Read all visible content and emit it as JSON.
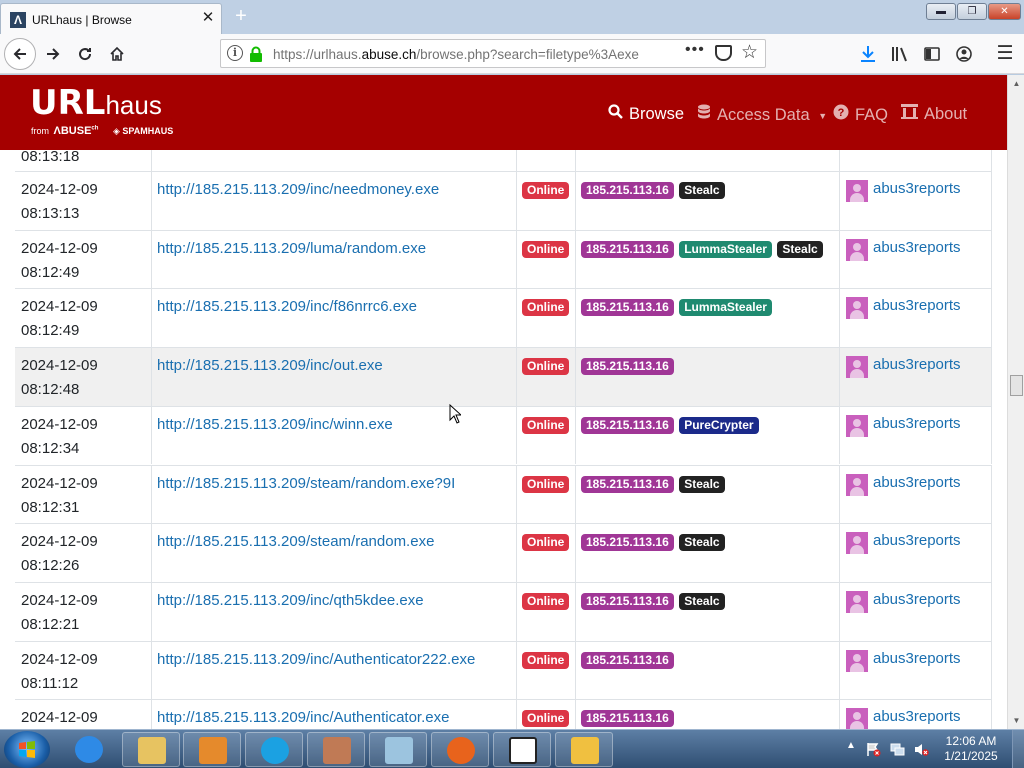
{
  "browser": {
    "tab_title": "URLhaus | Browse",
    "tab_favicon_letter": "Λ",
    "url_prefix": "https://urlhaus.",
    "url_domain": "abuse.ch",
    "url_suffix": "/browse.php?search=filetype%3Aexe",
    "new_tab_icon": "+",
    "window_buttons": {
      "minimize": "▬",
      "maximize": "❐",
      "close": "✕"
    }
  },
  "site": {
    "logo_url": "URL",
    "logo_haus": "haus",
    "logo_from": "from",
    "logo_abuse": "ΛBUSE",
    "logo_abuse_ch": "ch",
    "logo_spamhaus": "SPAMHAUS",
    "nav": {
      "browse": "Browse",
      "access": "Access Data",
      "faq": "FAQ",
      "about": "About"
    }
  },
  "table": {
    "top_partial_time": "08:13:18",
    "rows": [
      {
        "date": "2024-12-09",
        "time": "08:13:13",
        "url": "http://185.215.113.209/inc/needmoney.exe",
        "status": "Online",
        "ip": "185.215.113.16",
        "tags": [
          {
            "label": "Stealc",
            "kind": "stealc"
          }
        ],
        "reporter": "abus3reports"
      },
      {
        "date": "2024-12-09",
        "time": "08:12:49",
        "url": "http://185.215.113.209/luma/random.exe",
        "status": "Online",
        "ip": "185.215.113.16",
        "tags": [
          {
            "label": "LummaStealer",
            "kind": "lumma"
          },
          {
            "label": "Stealc",
            "kind": "stealc"
          }
        ],
        "reporter": "abus3reports"
      },
      {
        "date": "2024-12-09",
        "time": "08:12:49",
        "url": "http://185.215.113.209/inc/f86nrrc6.exe",
        "status": "Online",
        "ip": "185.215.113.16",
        "tags": [
          {
            "label": "LummaStealer",
            "kind": "lumma"
          }
        ],
        "reporter": "abus3reports"
      },
      {
        "date": "2024-12-09",
        "time": "08:12:48",
        "url": "http://185.215.113.209/inc/out.exe",
        "status": "Online",
        "ip": "185.215.113.16",
        "tags": [],
        "reporter": "abus3reports",
        "hover": true
      },
      {
        "date": "2024-12-09",
        "time": "08:12:34",
        "url": "http://185.215.113.209/inc/winn.exe",
        "status": "Online",
        "ip": "185.215.113.16",
        "tags": [
          {
            "label": "PureCrypter",
            "kind": "pure"
          }
        ],
        "reporter": "abus3reports"
      },
      {
        "date": "2024-12-09",
        "time": "08:12:31",
        "url": "http://185.215.113.209/steam/random.exe?9I",
        "status": "Online",
        "ip": "185.215.113.16",
        "tags": [
          {
            "label": "Stealc",
            "kind": "stealc"
          }
        ],
        "reporter": "abus3reports"
      },
      {
        "date": "2024-12-09",
        "time": "08:12:26",
        "url": "http://185.215.113.209/steam/random.exe",
        "status": "Online",
        "ip": "185.215.113.16",
        "tags": [
          {
            "label": "Stealc",
            "kind": "stealc"
          }
        ],
        "reporter": "abus3reports"
      },
      {
        "date": "2024-12-09",
        "time": "08:12:21",
        "url": "http://185.215.113.209/inc/qth5kdee.exe",
        "status": "Online",
        "ip": "185.215.113.16",
        "tags": [
          {
            "label": "Stealc",
            "kind": "stealc"
          }
        ],
        "reporter": "abus3reports"
      },
      {
        "date": "2024-12-09",
        "time": "08:11:12",
        "url": "http://185.215.113.209/inc/Authenticator222.exe",
        "status": "Online",
        "ip": "185.215.113.16",
        "tags": [],
        "reporter": "abus3reports"
      },
      {
        "date": "2024-12-09",
        "time": "",
        "url": "http://185.215.113.209/inc/Authenticator.exe",
        "status": "Online",
        "ip": "185.215.113.16",
        "tags": [],
        "reporter": "abus3reports"
      }
    ]
  },
  "taskbar": {
    "apps": [
      "internet-explorer",
      "windows-explorer",
      "media-player",
      "skype",
      "users",
      "notepad",
      "firefox",
      "7zip",
      "save-disk"
    ],
    "clock_time": "12:06 AM",
    "clock_date": "1/21/2025"
  },
  "colors": {
    "header_red": "#a50000",
    "link_blue": "#1a6fb0",
    "online_red": "#dc3545",
    "ip_purple": "#a03696"
  }
}
